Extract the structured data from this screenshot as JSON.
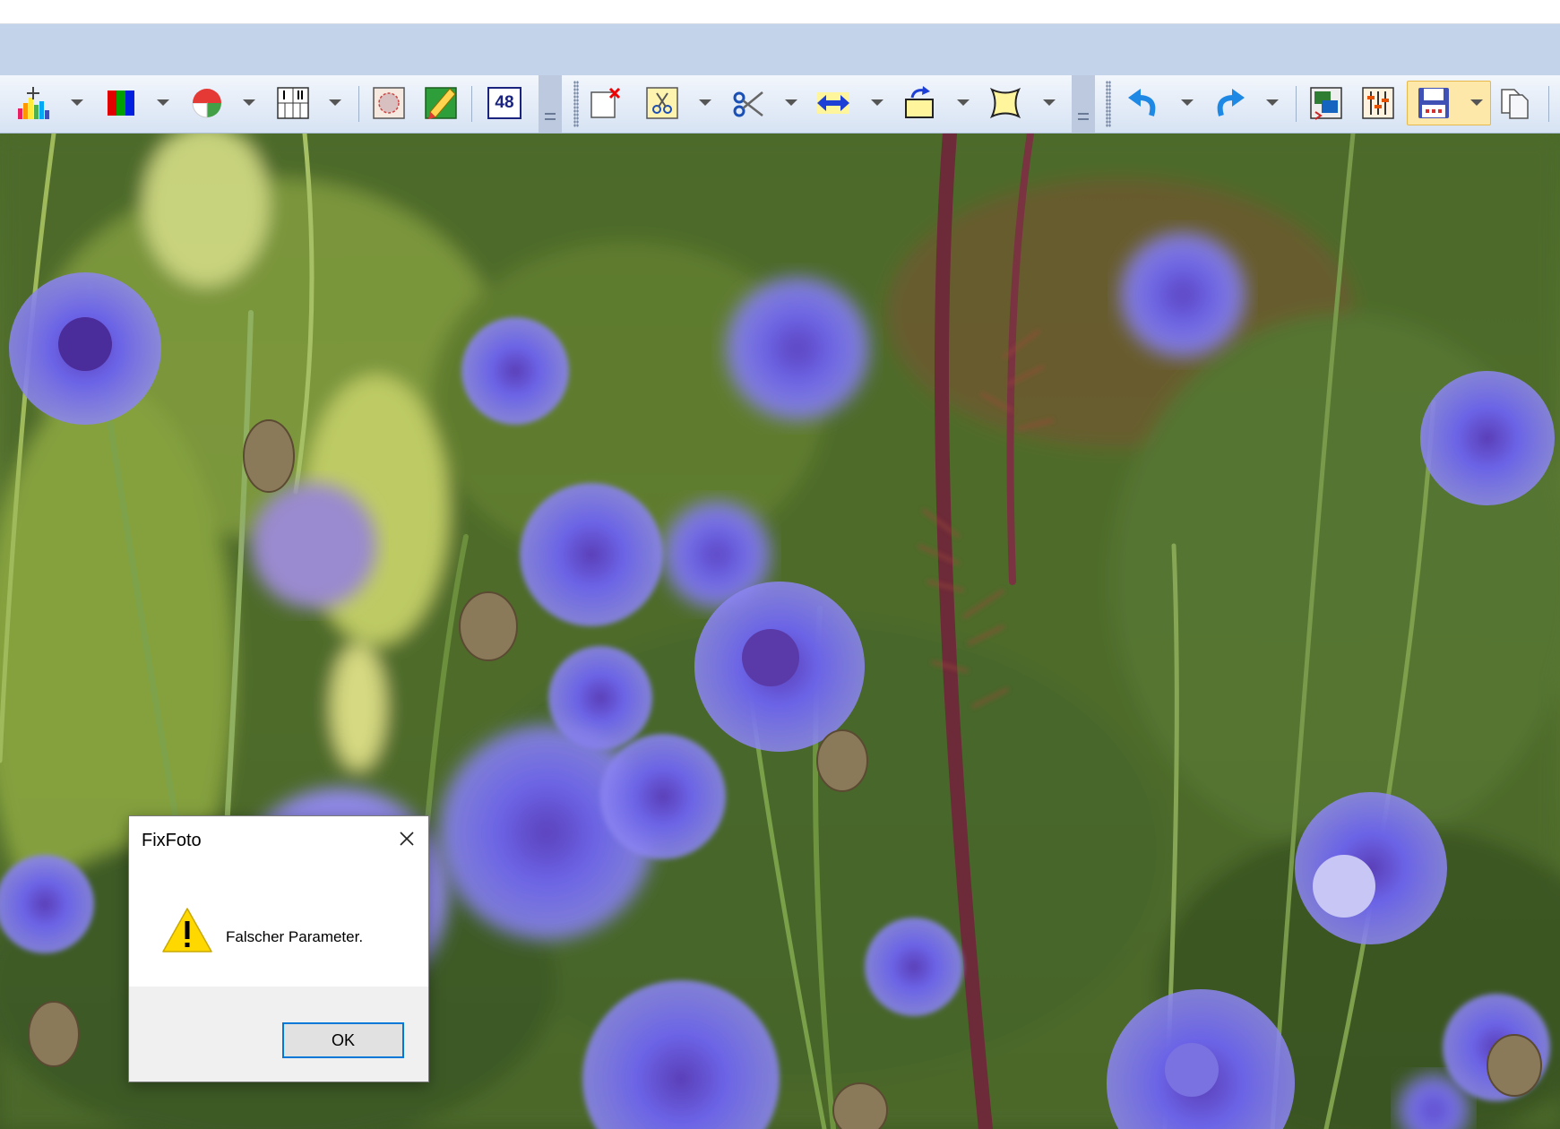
{
  "toolbar": {
    "buttons": [
      {
        "icon": "histogram-icon"
      },
      {
        "icon": "rgb-channels-icon"
      },
      {
        "icon": "color-wheel-icon"
      },
      {
        "icon": "contact-sheet-icon"
      },
      {
        "icon": "vignette-icon"
      },
      {
        "icon": "edit-image-icon"
      },
      {
        "icon": "resolution-48-icon",
        "label": "48"
      },
      {
        "icon": "crop-select-icon"
      },
      {
        "icon": "cut-clipboard-icon"
      },
      {
        "icon": "scissors-icon"
      },
      {
        "icon": "flip-horizontal-icon"
      },
      {
        "icon": "rotate-icon"
      },
      {
        "icon": "distort-frame-icon"
      },
      {
        "icon": "undo-icon"
      },
      {
        "icon": "redo-icon"
      },
      {
        "icon": "compare-images-icon"
      },
      {
        "icon": "adjust-levels-icon"
      },
      {
        "icon": "save-icon"
      },
      {
        "icon": "copy-pages-icon"
      }
    ]
  },
  "dialog": {
    "title": "FixFoto",
    "message": "Falscher Parameter.",
    "ok_label": "OK",
    "icon": "warning-icon"
  },
  "colors": {
    "accent": "#0078d7",
    "band": "#c3d3ea",
    "warning": "#ffd800"
  }
}
